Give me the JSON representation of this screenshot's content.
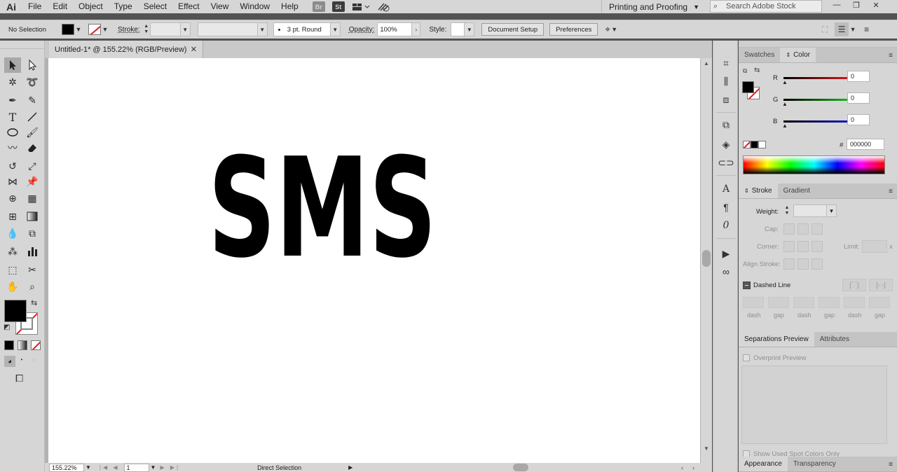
{
  "app": {
    "logo": "Ai"
  },
  "menu": [
    "File",
    "Edit",
    "Object",
    "Type",
    "Select",
    "Effect",
    "View",
    "Window",
    "Help"
  ],
  "menubar_icons": {
    "bridge": "Br",
    "stock": "St"
  },
  "workspace": {
    "label": "Printing and Proofing"
  },
  "search": {
    "placeholder": "Search Adobe Stock"
  },
  "control": {
    "selection": "No Selection",
    "stroke_label": "Stroke:",
    "brush": "3 pt. Round",
    "opacity_label": "Opacity:",
    "opacity_value": "100%",
    "style_label": "Style:",
    "document_setup": "Document Setup",
    "preferences": "Preferences"
  },
  "document": {
    "tab_title": "Untitled-1* @ 155.22% (RGB/Preview)",
    "artwork_text": "SMS"
  },
  "status": {
    "zoom": "155.22%",
    "page": "1",
    "tool": "Direct Selection"
  },
  "color_panel": {
    "tabs": [
      "Swatches",
      "Color"
    ],
    "active_tab": "Color",
    "r_label": "R",
    "g_label": "G",
    "b_label": "B",
    "r": "0",
    "g": "0",
    "b": "0",
    "hex_label": "#",
    "hex": "000000",
    "colors": {
      "red": "#e01b1b",
      "green": "#1ec01e",
      "blue": "#1b1bd0"
    }
  },
  "stroke_panel": {
    "tabs": [
      "Stroke",
      "Gradient"
    ],
    "weight_label": "Weight:",
    "cap_label": "Cap:",
    "corner_label": "Corner:",
    "limit_label": "Limit:",
    "limit_suffix": "x",
    "align_label": "Align Stroke:",
    "dashed_label": "Dashed Line",
    "dash_labels": [
      "dash",
      "gap",
      "dash",
      "gap",
      "dash",
      "gap"
    ]
  },
  "separations_panel": {
    "tabs": [
      "Separations Preview",
      "Attributes"
    ],
    "overprint": "Overprint Preview",
    "spot": "Show Used Spot Colors Only"
  },
  "appearance_panel": {
    "tabs": [
      "Appearance",
      "Transparency"
    ]
  }
}
